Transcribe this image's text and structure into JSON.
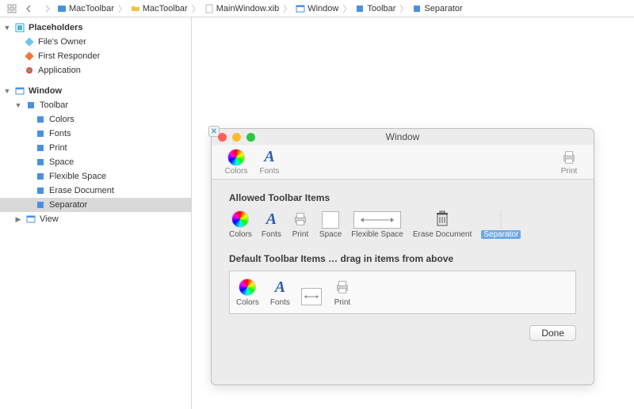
{
  "breadcrumb": [
    "MacToolbar",
    "MacToolbar",
    "MainWindow.xib",
    "Window",
    "Toolbar",
    "Separator"
  ],
  "sidebar": {
    "placeholders_label": "Placeholders",
    "placeholders": [
      "File's Owner",
      "First Responder",
      "Application"
    ],
    "window_label": "Window",
    "toolbar_label": "Toolbar",
    "toolbar_items": [
      "Colors",
      "Fonts",
      "Print",
      "Space",
      "Flexible Space",
      "Erase Document",
      "Separator"
    ],
    "view_label": "View"
  },
  "window": {
    "title": "Window",
    "toolbar": {
      "colors": "Colors",
      "fonts": "Fonts",
      "print": "Print"
    },
    "allowed_title": "Allowed Toolbar Items",
    "allowed": [
      "Colors",
      "Fonts",
      "Print",
      "Space",
      "Flexible Space",
      "Erase Document",
      "Separator"
    ],
    "default_title": "Default Toolbar Items … drag in items from above",
    "default": [
      "Colors",
      "Fonts",
      "",
      "Print"
    ],
    "done": "Done"
  }
}
